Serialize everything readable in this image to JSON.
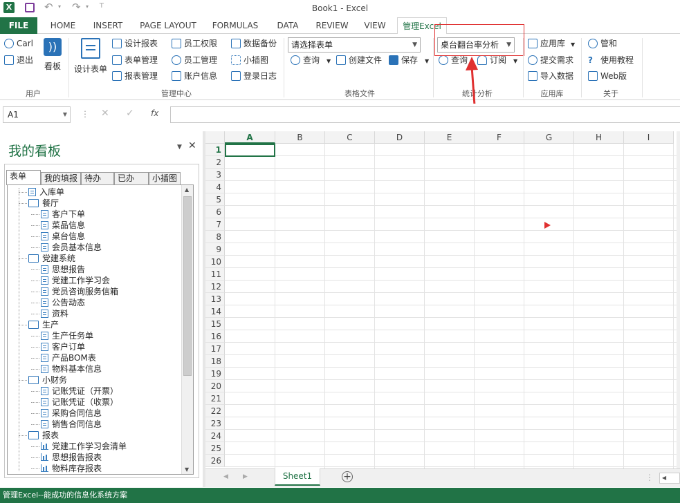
{
  "window": {
    "title": "Book1 - Excel"
  },
  "tabs": [
    "FILE",
    "HOME",
    "INSERT",
    "PAGE LAYOUT",
    "FORMULAS",
    "DATA",
    "REVIEW",
    "VIEW",
    "管理Excel"
  ],
  "ribbon": {
    "user": {
      "name": "Carl",
      "logout": "退出",
      "board": "看板",
      "group": "用户"
    },
    "mgmt": {
      "design_form": "设计表单",
      "design_report": "设计报表",
      "form_mgmt": "表单管理",
      "report_mgmt": "报表管理",
      "emp_perm": "员工权限",
      "emp_mgmt": "员工管理",
      "acct_info": "账户信息",
      "data_backup": "数据备份",
      "mini_chart": "小插图",
      "login_log": "登录日志",
      "group": "管理中心"
    },
    "form_file": {
      "select_placeholder": "请选择表单",
      "query": "查询",
      "create_file": "创建文件",
      "save": "保存",
      "group": "表格文件"
    },
    "stats": {
      "selected": "桌台翻台率分析",
      "query": "查询",
      "subscribe": "订阅",
      "group": "统计分析"
    },
    "apps": {
      "app_store": "应用库",
      "submit_req": "提交需求",
      "import_data": "导入数据",
      "group": "应用库"
    },
    "about": {
      "guanhe": "管和",
      "tutorial": "使用教程",
      "web": "Web版",
      "group": "关于"
    }
  },
  "formula": {
    "namebox": "A1",
    "fx": "fx"
  },
  "pane": {
    "title": "我的看板",
    "tabs": [
      "表单",
      "我的填报",
      "待办",
      "已办",
      "小插图"
    ]
  },
  "tree": [
    {
      "t": "入库单",
      "k": "doc",
      "l": 1
    },
    {
      "t": "餐厅",
      "k": "folder",
      "l": 1
    },
    {
      "t": "客户下单",
      "k": "doc",
      "l": 2
    },
    {
      "t": "菜品信息",
      "k": "doc",
      "l": 2
    },
    {
      "t": "桌台信息",
      "k": "doc",
      "l": 2
    },
    {
      "t": "会员基本信息",
      "k": "doc",
      "l": 2
    },
    {
      "t": "党建系统",
      "k": "folder",
      "l": 1
    },
    {
      "t": "思想报告",
      "k": "doc",
      "l": 2
    },
    {
      "t": "党建工作学习会",
      "k": "doc",
      "l": 2
    },
    {
      "t": "党员咨询服务信箱",
      "k": "doc",
      "l": 2
    },
    {
      "t": "公告动态",
      "k": "doc",
      "l": 2
    },
    {
      "t": "资料",
      "k": "doc",
      "l": 2
    },
    {
      "t": "生产",
      "k": "folder",
      "l": 1
    },
    {
      "t": "生产任务单",
      "k": "doc",
      "l": 2
    },
    {
      "t": "客户订单",
      "k": "doc",
      "l": 2
    },
    {
      "t": "产品BOM表",
      "k": "doc",
      "l": 2
    },
    {
      "t": "物料基本信息",
      "k": "doc",
      "l": 2
    },
    {
      "t": "小财务",
      "k": "folder",
      "l": 1
    },
    {
      "t": "记账凭证（开票）",
      "k": "doc",
      "l": 2
    },
    {
      "t": "记账凭证（收票）",
      "k": "doc",
      "l": 2
    },
    {
      "t": "采购合同信息",
      "k": "doc",
      "l": 2
    },
    {
      "t": "销售合同信息",
      "k": "doc",
      "l": 2
    },
    {
      "t": "报表",
      "k": "folder",
      "l": 1
    },
    {
      "t": "党建工作学习会清单",
      "k": "chart",
      "l": 2
    },
    {
      "t": "思想报告报表",
      "k": "chart",
      "l": 2
    },
    {
      "t": "物料库存报表",
      "k": "chart",
      "l": 2
    }
  ],
  "grid": {
    "columns": [
      "A",
      "B",
      "C",
      "D",
      "E",
      "F",
      "G",
      "H",
      "I"
    ],
    "rows": [
      "1",
      "2",
      "3",
      "4",
      "5",
      "6",
      "7",
      "8",
      "9",
      "10",
      "11",
      "12",
      "13",
      "14",
      "15",
      "16",
      "17",
      "18",
      "19",
      "20",
      "21",
      "22",
      "23",
      "24",
      "25",
      "26"
    ]
  },
  "sheets": {
    "active": "Sheet1"
  },
  "status": {
    "text": "管理Excel--能成功的信息化系统方案"
  },
  "colors": {
    "brand": "#217346",
    "highlight": "#e03030",
    "icon": "#2a72b7"
  }
}
